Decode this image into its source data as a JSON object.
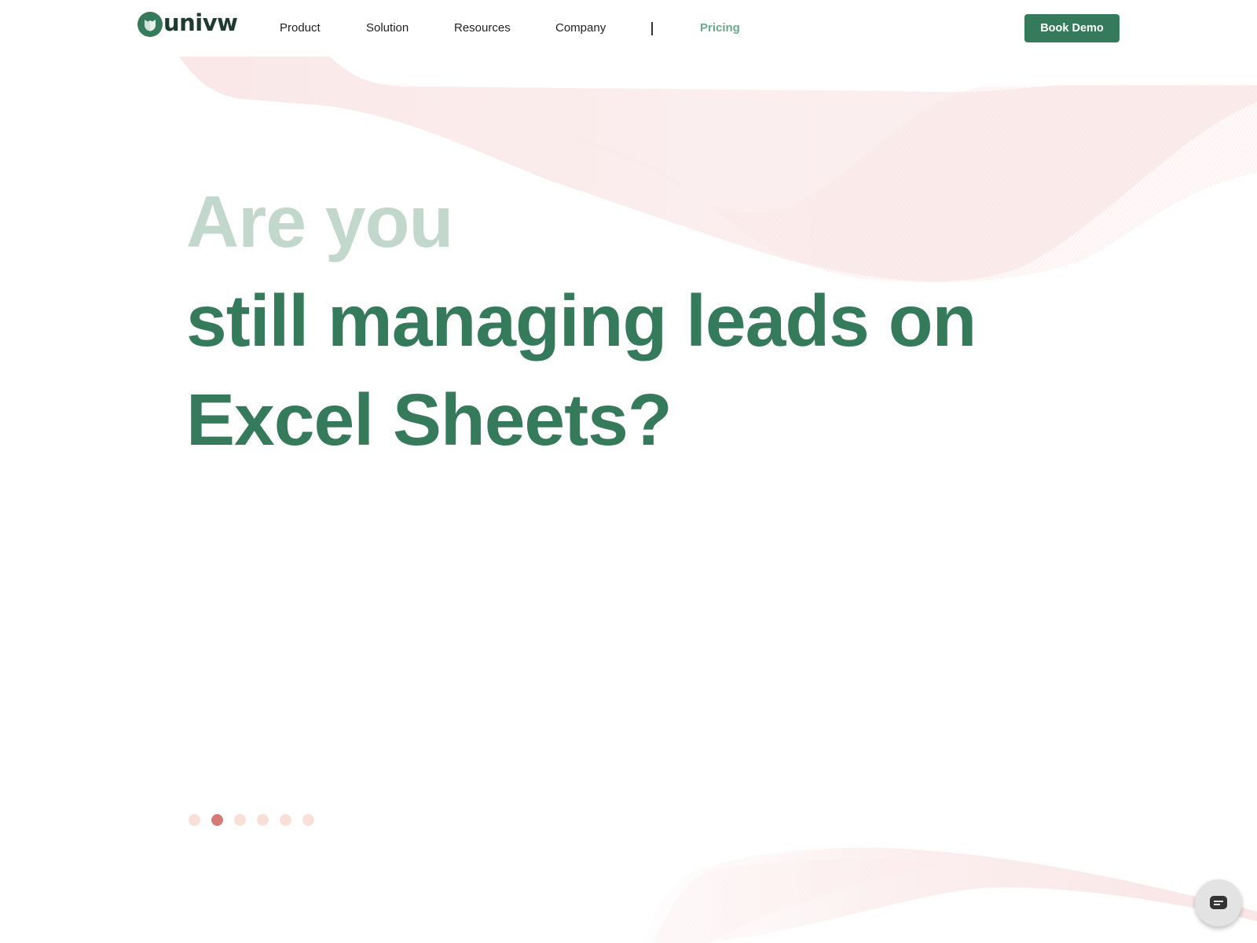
{
  "brand": {
    "name": "univw",
    "primary_color": "#347a5b",
    "logo_dark_color": "#1f3a2e"
  },
  "nav": {
    "items": [
      {
        "label": "Product"
      },
      {
        "label": "Solution"
      },
      {
        "label": "Resources"
      },
      {
        "label": "Company"
      },
      {
        "label": "Pricing"
      }
    ],
    "cta_label": "Book Demo"
  },
  "hero": {
    "line1": "Are you",
    "line2": "still managing leads on",
    "line3": "Excel Sheets?"
  },
  "carousel": {
    "total_slides": 6,
    "active_index": 1
  },
  "icons": {
    "logo": "shield-leaf-logo-icon",
    "chat": "chat-bubble-icon"
  }
}
